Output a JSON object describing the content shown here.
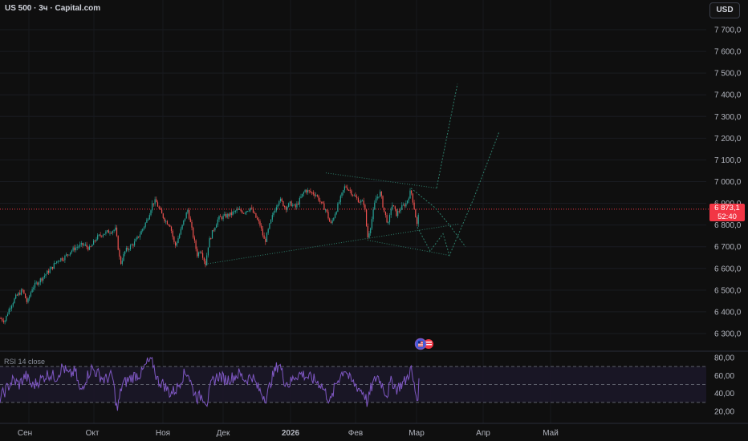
{
  "header": {
    "title": "US 500 · 3ч · Capital.com",
    "currency_button": "USD"
  },
  "price_tag": {
    "price": "6 873,1",
    "countdown": "52:40"
  },
  "rsi": {
    "label": "RSI 14 close",
    "levels": [
      "80,00",
      "60,00",
      "40,00",
      "20,00"
    ]
  },
  "price_axis": {
    "labels": [
      "7 700,0",
      "7 600,0",
      "7 500,0",
      "7 400,0",
      "7 300,0",
      "7 200,0",
      "7 100,0",
      "7 000,0",
      "6 900,0",
      "6 800,0",
      "6 700,0",
      "6 600,0",
      "6 500,0",
      "6 400,0",
      "6 300,0"
    ]
  },
  "time_axis": {
    "labels": [
      "Сен",
      "Окт",
      "Ноя",
      "Дек",
      "2026",
      "Фев",
      "Мар",
      "Апр",
      "Май"
    ],
    "bold": "2026"
  },
  "colors": {
    "background": "#0f0f0f",
    "up": "#26a69a",
    "down": "#ef5350",
    "last_price": "#f23645",
    "rsi_line": "#7e57c2",
    "rsi_band": "#1e1a2e",
    "trendline": "#2e7d6a"
  },
  "icons": {
    "event_badge": "us-flag-event-icon"
  },
  "chart_data": {
    "type": "candlestick",
    "symbol": "US 500",
    "timeframe": "3ч",
    "source": "Capital.com",
    "ylim": [
      6250,
      7800
    ],
    "last_price": 6873.1,
    "rsi_levels": [
      70,
      50,
      30
    ],
    "rsi_ylim": [
      15,
      85
    ],
    "path_points": [
      [
        0,
        6370
      ],
      [
        6,
        6360
      ],
      [
        12,
        6420
      ],
      [
        20,
        6470
      ],
      [
        28,
        6500
      ],
      [
        34,
        6440
      ],
      [
        40,
        6510
      ],
      [
        48,
        6540
      ],
      [
        56,
        6570
      ],
      [
        64,
        6600
      ],
      [
        72,
        6640
      ],
      [
        80,
        6650
      ],
      [
        88,
        6680
      ],
      [
        96,
        6700
      ],
      [
        104,
        6710
      ],
      [
        112,
        6690
      ],
      [
        120,
        6740
      ],
      [
        128,
        6760
      ],
      [
        136,
        6770
      ],
      [
        144,
        6780
      ],
      [
        150,
        6620
      ],
      [
        156,
        6680
      ],
      [
        162,
        6700
      ],
      [
        168,
        6720
      ],
      [
        176,
        6770
      ],
      [
        184,
        6830
      ],
      [
        190,
        6900
      ],
      [
        194,
        6910
      ],
      [
        200,
        6860
      ],
      [
        206,
        6820
      ],
      [
        212,
        6800
      ],
      [
        218,
        6700
      ],
      [
        224,
        6760
      ],
      [
        230,
        6830
      ],
      [
        234,
        6870
      ],
      [
        240,
        6760
      ],
      [
        246,
        6660
      ],
      [
        250,
        6690
      ],
      [
        256,
        6620
      ],
      [
        260,
        6720
      ],
      [
        266,
        6780
      ],
      [
        272,
        6830
      ],
      [
        280,
        6840
      ],
      [
        288,
        6850
      ],
      [
        296,
        6870
      ],
      [
        304,
        6860
      ],
      [
        312,
        6880
      ],
      [
        318,
        6840
      ],
      [
        324,
        6800
      ],
      [
        330,
        6720
      ],
      [
        336,
        6800
      ],
      [
        342,
        6870
      ],
      [
        348,
        6920
      ],
      [
        356,
        6880
      ],
      [
        362,
        6900
      ],
      [
        368,
        6880
      ],
      [
        374,
        6920
      ],
      [
        380,
        6960
      ],
      [
        388,
        6950
      ],
      [
        394,
        6940
      ],
      [
        400,
        6900
      ],
      [
        406,
        6870
      ],
      [
        412,
        6800
      ],
      [
        418,
        6860
      ],
      [
        424,
        6920
      ],
      [
        430,
        6980
      ],
      [
        436,
        6960
      ],
      [
        442,
        6930
      ],
      [
        448,
        6910
      ],
      [
        454,
        6900
      ],
      [
        458,
        6740
      ],
      [
        462,
        6800
      ],
      [
        468,
        6920
      ],
      [
        474,
        6950
      ],
      [
        478,
        6870
      ],
      [
        484,
        6800
      ],
      [
        488,
        6900
      ],
      [
        494,
        6850
      ],
      [
        500,
        6880
      ],
      [
        506,
        6900
      ],
      [
        512,
        6960
      ],
      [
        516,
        6880
      ],
      [
        520,
        6790
      ],
      [
        522,
        6873
      ]
    ],
    "rsi_points": [
      [
        0,
        35
      ],
      [
        8,
        45
      ],
      [
        16,
        55
      ],
      [
        24,
        50
      ],
      [
        32,
        60
      ],
      [
        40,
        48
      ],
      [
        50,
        55
      ],
      [
        60,
        62
      ],
      [
        70,
        58
      ],
      [
        78,
        70
      ],
      [
        86,
        60
      ],
      [
        94,
        65
      ],
      [
        100,
        40
      ],
      [
        106,
        55
      ],
      [
        114,
        68
      ],
      [
        122,
        62
      ],
      [
        130,
        55
      ],
      [
        140,
        60
      ],
      [
        146,
        20
      ],
      [
        152,
        50
      ],
      [
        160,
        55
      ],
      [
        168,
        60
      ],
      [
        176,
        62
      ],
      [
        184,
        75
      ],
      [
        190,
        76
      ],
      [
        196,
        55
      ],
      [
        204,
        50
      ],
      [
        212,
        40
      ],
      [
        220,
        45
      ],
      [
        228,
        60
      ],
      [
        234,
        64
      ],
      [
        240,
        45
      ],
      [
        246,
        35
      ],
      [
        252,
        38
      ],
      [
        258,
        30
      ],
      [
        264,
        52
      ],
      [
        272,
        60
      ],
      [
        282,
        55
      ],
      [
        290,
        58
      ],
      [
        298,
        62
      ],
      [
        306,
        55
      ],
      [
        314,
        60
      ],
      [
        320,
        48
      ],
      [
        326,
        40
      ],
      [
        332,
        35
      ],
      [
        338,
        55
      ],
      [
        344,
        68
      ],
      [
        348,
        74
      ],
      [
        354,
        55
      ],
      [
        360,
        50
      ],
      [
        368,
        60
      ],
      [
        376,
        62
      ],
      [
        384,
        58
      ],
      [
        392,
        55
      ],
      [
        400,
        50
      ],
      [
        406,
        40
      ],
      [
        412,
        30
      ],
      [
        418,
        50
      ],
      [
        424,
        60
      ],
      [
        430,
        68
      ],
      [
        436,
        55
      ],
      [
        442,
        50
      ],
      [
        448,
        45
      ],
      [
        454,
        40
      ],
      [
        458,
        28
      ],
      [
        462,
        45
      ],
      [
        470,
        60
      ],
      [
        476,
        50
      ],
      [
        482,
        38
      ],
      [
        488,
        55
      ],
      [
        494,
        45
      ],
      [
        500,
        50
      ],
      [
        506,
        55
      ],
      [
        512,
        68
      ],
      [
        516,
        48
      ],
      [
        520,
        32
      ],
      [
        522,
        50
      ]
    ],
    "trendlines": [
      {
        "from": [
          256,
          6620
        ],
        "to": [
          572,
          6805
        ],
        "style": "dotted"
      },
      {
        "from": [
          406,
          7040
        ],
        "to": [
          544,
          6970
        ],
        "style": "dotted"
      },
      {
        "from": [
          458,
          6730
        ],
        "to": [
          560,
          6660
        ],
        "style": "dotted"
      }
    ],
    "forecast_paths": [
      [
        [
          512,
          6970
        ],
        [
          542,
          6880
        ],
        [
          560,
          6800
        ],
        [
          580,
          6700
        ]
      ],
      [
        [
          520,
          6790
        ],
        [
          536,
          6680
        ],
        [
          552,
          6760
        ],
        [
          560,
          6660
        ],
        [
          590,
          6920
        ],
        [
          622,
          7230
        ]
      ],
      [
        [
          544,
          6970
        ],
        [
          570,
          7450
        ]
      ]
    ]
  }
}
